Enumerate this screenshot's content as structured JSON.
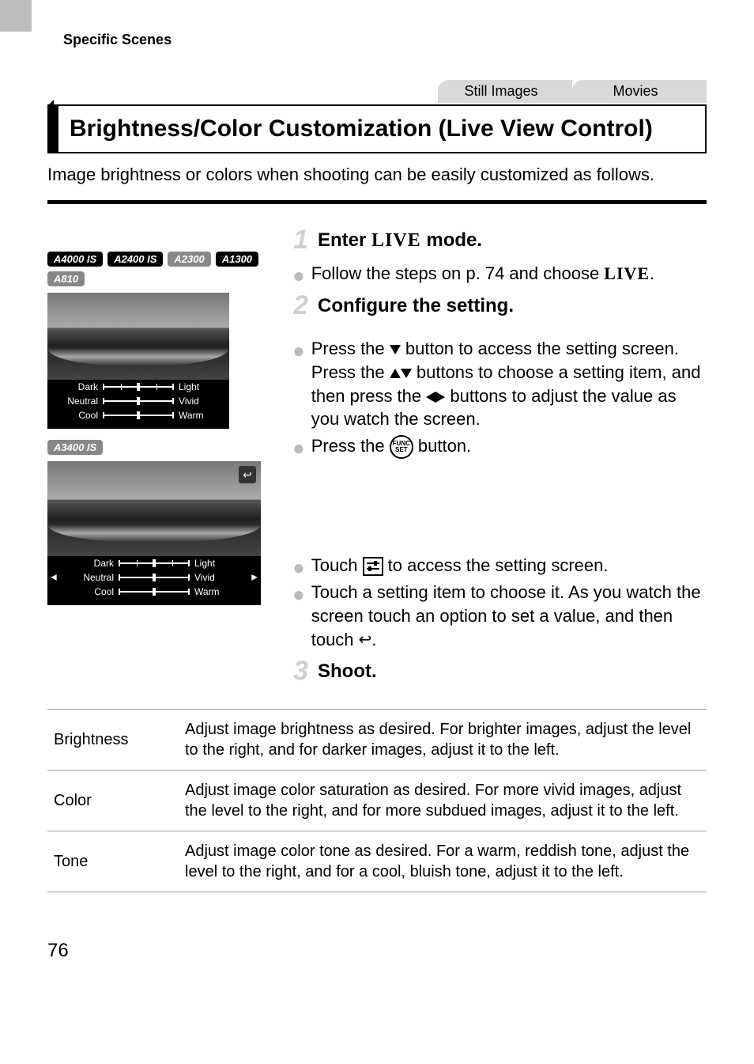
{
  "header": "Specific Scenes",
  "media_tabs": [
    "Still Images",
    "Movies"
  ],
  "title": "Brightness/Color Customization (Live View Control)",
  "intro": "Image brightness or colors when shooting can be easily customized as follows.",
  "steps": {
    "s1": {
      "num": "1",
      "title_prefix": "Enter ",
      "title_suffix": " mode.",
      "live_word": "LIVE",
      "body1_prefix": "Follow the steps on p. 74 and choose ",
      "body1_suffix": "."
    },
    "s2": {
      "num": "2",
      "title": "Configure the setting.",
      "body1": "Press the ▼ button to access the setting screen. Press the ▲▼ buttons to choose a setting item, and then press the ◀▶ buttons to adjust the value as you watch the screen.",
      "body2_prefix": "Press the ",
      "body2_suffix": " button.",
      "touch1_prefix": "Touch ",
      "touch1_suffix": " to access the setting screen.",
      "touch2_prefix": "Touch a setting item to choose it. As you watch the screen touch an option to set a value, and then touch ",
      "touch2_suffix": "."
    },
    "s3": {
      "num": "3",
      "title": "Shoot."
    }
  },
  "model_groups": {
    "group1": [
      "A4000 IS",
      "A2400 IS",
      "A2300",
      "A1300",
      "A810"
    ],
    "group2": [
      "A3400 IS"
    ]
  },
  "slider_labels": {
    "row1": {
      "left": "Dark",
      "right": "Light"
    },
    "row2": {
      "left": "Neutral",
      "right": "Vivid"
    },
    "row3": {
      "left": "Cool",
      "right": "Warm"
    }
  },
  "func_label": "FUNC\nSET",
  "table": {
    "rows": [
      {
        "name": "Brightness",
        "desc": "Adjust image brightness as desired. For brighter images, adjust the level to the right, and for darker images, adjust it to the left."
      },
      {
        "name": "Color",
        "desc": "Adjust image color saturation as desired. For more vivid images, adjust the level to the right, and for more subdued images, adjust it to the left."
      },
      {
        "name": "Tone",
        "desc": "Adjust image color tone as desired. For a warm, reddish tone, adjust the level to the right, and for a cool, bluish tone, adjust it to the left."
      }
    ]
  },
  "page_number": "76"
}
